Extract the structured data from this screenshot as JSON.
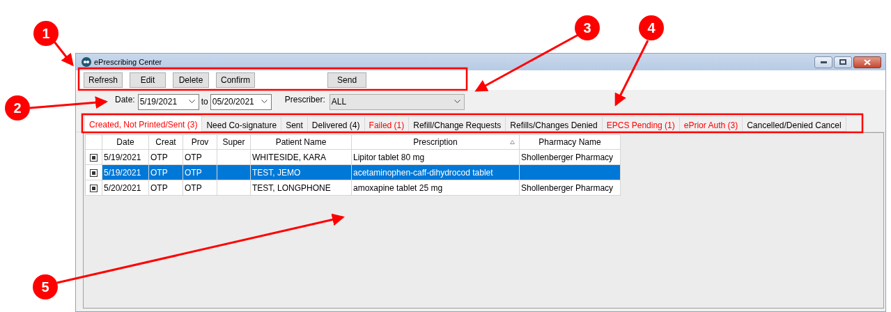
{
  "window": {
    "title": "ePrescribing Center"
  },
  "toolbar": [
    {
      "label": "Refresh"
    },
    {
      "label": "Edit"
    },
    {
      "label": "Delete"
    },
    {
      "label": "Confirm"
    },
    {
      "label": "Send",
      "kind": "spaced"
    }
  ],
  "filters": {
    "date_label": "Date:",
    "date_from": "5/19/2021",
    "to_label": "to",
    "date_to": "05/20/2021",
    "prescriber_label": "Prescriber:",
    "prescriber": "ALL"
  },
  "tabs": [
    {
      "label": "Created, Not Printed/Sent (3)",
      "alert": true,
      "selected": true
    },
    {
      "label": "Need Co-signature",
      "alert": false,
      "selected": false
    },
    {
      "label": "Sent",
      "alert": false,
      "selected": false
    },
    {
      "label": "Delivered (4)",
      "alert": false,
      "selected": false
    },
    {
      "label": "Failed (1)",
      "alert": true,
      "selected": false
    },
    {
      "label": "Refill/Change Requests",
      "alert": false,
      "selected": false
    },
    {
      "label": "Refills/Changes Denied",
      "alert": false,
      "selected": false
    },
    {
      "label": "EPCS Pending (1)",
      "alert": true,
      "selected": false
    },
    {
      "label": "ePrior Auth (3)",
      "alert": true,
      "selected": false
    },
    {
      "label": "Cancelled/Denied Cancel",
      "alert": false,
      "selected": false
    }
  ],
  "table": {
    "columns": [
      {
        "label": "Date",
        "sorted": false
      },
      {
        "label": "Creat",
        "sorted": false
      },
      {
        "label": "Prov",
        "sorted": false
      },
      {
        "label": "Super",
        "sorted": false
      },
      {
        "label": "Patient Name",
        "sorted": false
      },
      {
        "label": "Prescription",
        "sorted": true
      },
      {
        "label": "Pharmacy Name",
        "sorted": false
      }
    ],
    "rows": [
      {
        "selected": false,
        "cells": [
          "5/19/2021",
          "OTP",
          "OTP",
          "",
          "WHITESIDE, KARA",
          "Lipitor tablet 80 mg",
          "Shollenberger Pharmacy"
        ]
      },
      {
        "selected": true,
        "cells": [
          "5/19/2021",
          "OTP",
          "OTP",
          "",
          "TEST, JEMO",
          "acetaminophen-caff-dihydrocod tablet",
          ""
        ]
      },
      {
        "selected": false,
        "cells": [
          "5/20/2021",
          "OTP",
          "OTP",
          "",
          "TEST, LONGPHONE",
          "amoxapine tablet 25 mg",
          "Shollenberger Pharmacy"
        ]
      }
    ]
  },
  "annotations": [
    {
      "label": "1"
    },
    {
      "label": "2"
    },
    {
      "label": "3"
    },
    {
      "label": "4"
    },
    {
      "label": "5"
    }
  ]
}
